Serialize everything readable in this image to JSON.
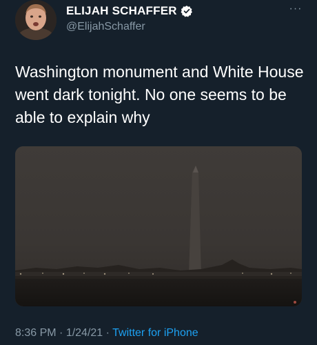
{
  "user": {
    "display_name": "ELIJAH SCHAFFER",
    "handle": "@ElijahSchaffer",
    "verified": true,
    "avatar_icon": "user-avatar"
  },
  "menu": {
    "more_icon": "more-horizontal-icon",
    "more_label": "···"
  },
  "tweet": {
    "text": "Washington monument and White House went dark tonight. No one seems to be able to explain why",
    "media_description_icon": "photo-washington-monument-night"
  },
  "meta": {
    "time": "8:36 PM",
    "separator": " · ",
    "date": "1/24/21",
    "source": "Twitter for iPhone"
  },
  "colors": {
    "background": "#15202b",
    "text_primary": "#ffffff",
    "text_secondary": "#8899a6",
    "link": "#1da1f2"
  }
}
